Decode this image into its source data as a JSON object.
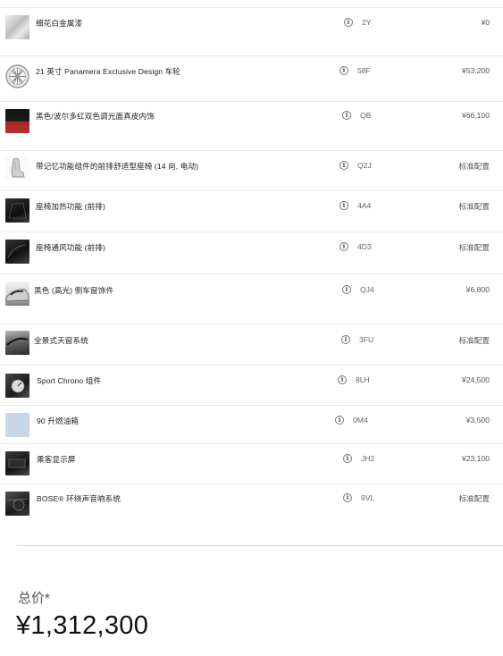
{
  "options": [
    {
      "name": "细花白金属漆",
      "code": "2Y",
      "price": "¥0",
      "thumb": "metallic-white-paint-swatch"
    },
    {
      "name": "21 英寸 Panamera Exclusive Design 车轮",
      "code": "58F",
      "price": "¥53,200",
      "thumb": "wheel-rim"
    },
    {
      "name": "黑色/波尔多红双色调光面真皮内饰",
      "code": "QB",
      "price": "¥66,100",
      "thumb": "black-bordeaux-red-swatch"
    },
    {
      "name": "带记忆功能组件的前排舒适型座椅 (14 向, 电动)",
      "code": "Q2J",
      "price": "标准配置",
      "thumb": "seat-image"
    },
    {
      "name": "座椅加热功能 (前排)",
      "code": "4A4",
      "price": "标准配置",
      "thumb": "seat-heating-image"
    },
    {
      "name": "座椅通风功能 (前排)",
      "code": "4D3",
      "price": "标准配置",
      "thumb": "seat-ventilation-image"
    },
    {
      "name": "黑色 (高光) 侧车窗饰件",
      "code": "QJ4",
      "price": "¥6,800",
      "thumb": "car-window-trim-image"
    },
    {
      "name": "全景式天窗系统",
      "code": "3FU",
      "price": "标准配置",
      "thumb": "panoramic-roof-image"
    },
    {
      "name": "Sport Chrono 组件",
      "code": "8LH",
      "price": "¥24,500",
      "thumb": "sport-chrono-image"
    },
    {
      "name": "90 升燃油箱",
      "code": "0M4",
      "price": "¥3,500",
      "thumb": "fuel-tank-placeholder"
    },
    {
      "name": "乘客显示屏",
      "code": "JH2",
      "price": "¥23,100",
      "thumb": "passenger-display-image"
    },
    {
      "name": "BOSE® 环绕声音响系统",
      "code": "9VL",
      "price": "标准配置",
      "thumb": "bose-speaker-image"
    }
  ],
  "info_icon_glyph": "i",
  "total": {
    "label": "总价*",
    "value": "¥1,312,300"
  }
}
